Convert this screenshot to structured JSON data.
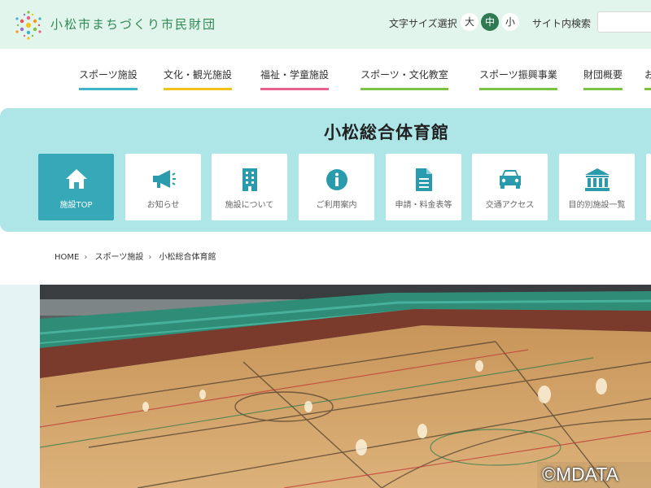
{
  "header": {
    "org_name": "小松市まちづくり市民財団",
    "font_size_label": "文字サイズ選択",
    "font_sizes": [
      {
        "label": "大",
        "active": false
      },
      {
        "label": "中",
        "active": true
      },
      {
        "label": "小",
        "active": false
      }
    ],
    "search_label": "サイト内検索",
    "search_value": ""
  },
  "nav": {
    "items": [
      {
        "label": "スポーツ施設",
        "color": "#3fb6c8"
      },
      {
        "label": "文化・観光施設",
        "color": "#f2c21b"
      },
      {
        "label": "福祉・学童施設",
        "color": "#e8608b"
      },
      {
        "label": "スポーツ・文化教室",
        "color": "#7cc242"
      },
      {
        "label": "スポーツ振興事業",
        "color": "#7cc242"
      },
      {
        "label": "財団概要",
        "color": "#7cc242"
      },
      {
        "label": "お",
        "color": "#7cc242"
      }
    ]
  },
  "facility": {
    "title": "小松総合体育館",
    "cards": [
      {
        "label": "施設TOP",
        "icon": "home-icon",
        "active": true
      },
      {
        "label": "お知らせ",
        "icon": "megaphone-icon",
        "active": false
      },
      {
        "label": "施設について",
        "icon": "building-icon",
        "active": false
      },
      {
        "label": "ご利用案内",
        "icon": "info-icon",
        "active": false
      },
      {
        "label": "申請・料金表等",
        "icon": "document-icon",
        "active": false
      },
      {
        "label": "交通アクセス",
        "icon": "car-icon",
        "active": false
      },
      {
        "label": "目的別施設一覧",
        "icon": "institution-icon",
        "active": false
      }
    ]
  },
  "breadcrumb": [
    "HOME",
    "スポーツ施設",
    "小松総合体育館"
  ],
  "hero": {
    "watermark": "©MDATA"
  },
  "colors": {
    "header_bg": "#e2f5ec",
    "brand_green": "#2f8a55",
    "panel_bg": "#aee6e8",
    "active_card": "#37a8b8",
    "icon_teal": "#2a9bac"
  }
}
